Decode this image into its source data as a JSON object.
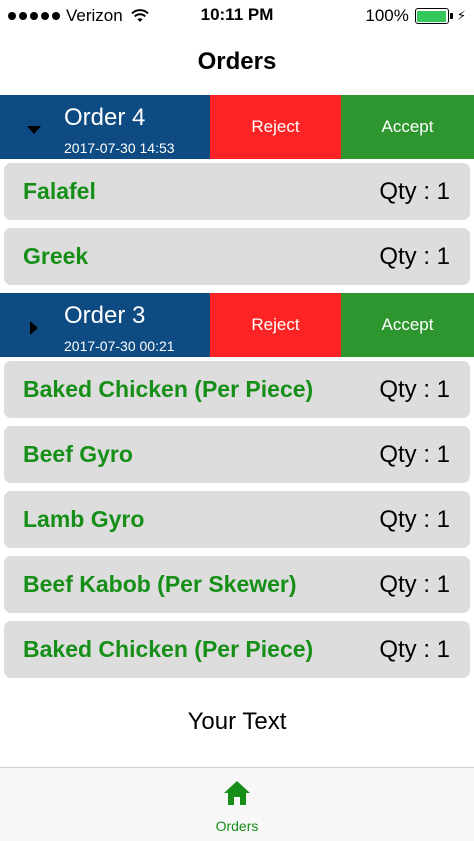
{
  "status_bar": {
    "carrier": "Verizon",
    "time": "10:11 PM",
    "battery": "100%",
    "battery_color": "#34c759"
  },
  "nav": {
    "title": "Orders"
  },
  "orders": [
    {
      "title": "Order 4",
      "date": "2017-07-30 14:53",
      "reject_label": "Reject",
      "accept_label": "Accept",
      "expanded": true,
      "items": [
        {
          "name": "Falafel",
          "qty": "Qty : 1"
        },
        {
          "name": "Greek",
          "qty": "Qty : 1"
        }
      ]
    },
    {
      "title": "Order 3",
      "date": "2017-07-30 00:21",
      "reject_label": "Reject",
      "accept_label": "Accept",
      "expanded": false,
      "items": [
        {
          "name": "Baked Chicken (Per Piece)",
          "qty": "Qty : 1"
        },
        {
          "name": "Beef Gyro",
          "qty": "Qty : 1"
        },
        {
          "name": "Lamb Gyro",
          "qty": "Qty : 1"
        },
        {
          "name": "Beef Kabob (Per Skewer)",
          "qty": "Qty : 1"
        },
        {
          "name": "Baked Chicken (Per Piece)",
          "qty": "Qty : 1"
        }
      ]
    }
  ],
  "footer_text": "Your Text",
  "tab_bar": {
    "tabs": [
      {
        "label": "Orders",
        "icon": "home-icon",
        "selected": true
      }
    ]
  },
  "colors": {
    "order_header": "#0d4b82",
    "reject": "#fb2323",
    "accept": "#2e962f",
    "item_text": "#168f18",
    "item_bg": "#dddddd"
  }
}
